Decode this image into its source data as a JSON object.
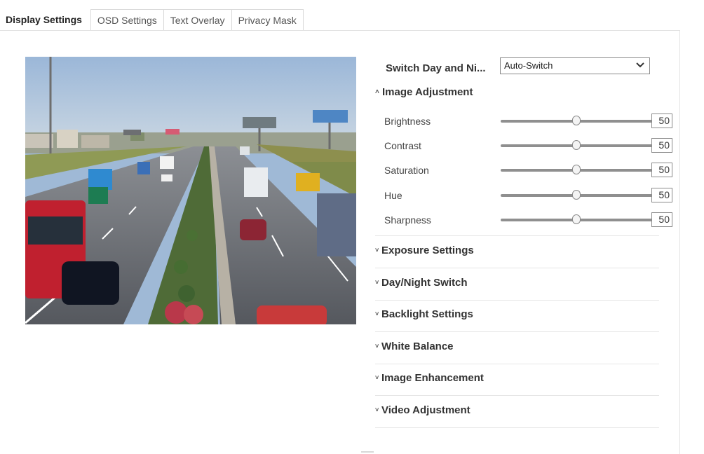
{
  "tabs": [
    {
      "label": "Display Settings",
      "active": true
    },
    {
      "label": "OSD Settings",
      "active": false
    },
    {
      "label": "Text Overlay",
      "active": false
    },
    {
      "label": "Privacy Mask",
      "active": false
    }
  ],
  "switch_day_night": {
    "label": "Switch Day and Ni...",
    "value": "Auto-Switch"
  },
  "image_adjustment": {
    "title": "Image Adjustment",
    "sliders": [
      {
        "name": "Brightness",
        "value": 50
      },
      {
        "name": "Contrast",
        "value": 50
      },
      {
        "name": "Saturation",
        "value": 50
      },
      {
        "name": "Hue",
        "value": 50
      },
      {
        "name": "Sharpness",
        "value": 50
      }
    ]
  },
  "collapsed_sections": [
    "Exposure Settings",
    "Day/Night Switch",
    "Backlight Settings",
    "White Balance",
    "Image Enhancement",
    "Video Adjustment"
  ],
  "icons": {
    "dropdown": "chevron-down-icon",
    "expanded": "caret-up-icon",
    "collapsed": "caret-down-icon"
  },
  "colors": {
    "tab_border": "#d9d9d9",
    "track": "#8f8f8f",
    "field_border": "#8a8a8a"
  }
}
